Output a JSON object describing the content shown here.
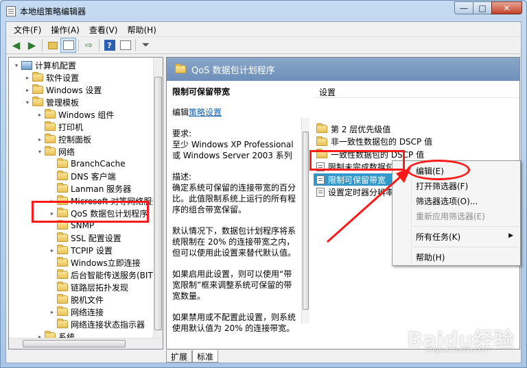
{
  "window": {
    "title": "本地组策略编辑器",
    "min": "—",
    "max": "□",
    "close": "✕"
  },
  "menu": [
    "文件(F)",
    "操作(A)",
    "查看(V)",
    "帮助(H)"
  ],
  "toolbar": {
    "icons": [
      "back-arrow-icon",
      "forward-arrow-icon",
      "up-folder-icon",
      "show-tree-icon",
      "export-icon",
      "help-icon",
      "properties-icon",
      "filter-icon"
    ]
  },
  "tree": {
    "items": [
      {
        "label": "计算机配置",
        "level": 0,
        "expander": "▾",
        "icon": "computer"
      },
      {
        "label": "软件设置",
        "level": 1,
        "expander": "▸",
        "icon": "folder"
      },
      {
        "label": "Windows 设置",
        "level": 1,
        "expander": "▸",
        "icon": "folder"
      },
      {
        "label": "管理模板",
        "level": 1,
        "expander": "▾",
        "icon": "folder"
      },
      {
        "label": "Windows 组件",
        "level": 2,
        "expander": "▸",
        "icon": "folder"
      },
      {
        "label": "打印机",
        "level": 2,
        "expander": "",
        "icon": "folder"
      },
      {
        "label": "控制面板",
        "level": 2,
        "expander": "▸",
        "icon": "folder"
      },
      {
        "label": "网络",
        "level": 2,
        "expander": "▾",
        "icon": "folder"
      },
      {
        "label": "BranchCache",
        "level": 3,
        "expander": "",
        "icon": "folder"
      },
      {
        "label": "DNS 客户端",
        "level": 3,
        "expander": "",
        "icon": "folder"
      },
      {
        "label": "Lanman 服务器",
        "level": 3,
        "expander": "",
        "icon": "folder"
      },
      {
        "label": "Microsoft 对等网络服务",
        "level": 3,
        "expander": "▸",
        "icon": "folder"
      },
      {
        "label": "QoS 数据包计划程序",
        "level": 3,
        "expander": "▸",
        "icon": "folder"
      },
      {
        "label": "SNMP",
        "level": 3,
        "expander": "",
        "icon": "folder"
      },
      {
        "label": "SSL 配置设置",
        "level": 3,
        "expander": "",
        "icon": "folder"
      },
      {
        "label": "TCPIP 设置",
        "level": 3,
        "expander": "▸",
        "icon": "folder"
      },
      {
        "label": "Windows立即连接",
        "level": 3,
        "expander": "",
        "icon": "folder"
      },
      {
        "label": "后台智能传送服务(BITS)",
        "level": 3,
        "expander": "",
        "icon": "folder"
      },
      {
        "label": "链路层拓扑发现",
        "level": 3,
        "expander": "",
        "icon": "folder"
      },
      {
        "label": "脱机文件",
        "level": 3,
        "expander": "",
        "icon": "folder"
      },
      {
        "label": "网络连接",
        "level": 3,
        "expander": "▸",
        "icon": "folder"
      },
      {
        "label": "网络连接状态指示器",
        "level": 3,
        "expander": "",
        "icon": "folder"
      },
      {
        "label": "系统",
        "level": 2,
        "expander": "▸",
        "icon": "folder"
      }
    ]
  },
  "right": {
    "header": "QoS 数据包计划程序",
    "desc": {
      "title": "限制可保留带宽",
      "edit_prefix": "编辑",
      "edit_link": "策略设置",
      "req_label": "要求:",
      "req_text": "至少 Windows XP Professional 或 Windows Server 2003 系列",
      "desc_label": "描述:",
      "desc_text": "确定系统可保留的连接带宽的百分比。此值限制系统上运行的所有程序的组合带宽保留。",
      "default_text": "默认情况下，数据包计划程序将系统限制在 20% 的连接带宽之内，但可以使用此设置来替代默认值。",
      "enable_text": "如果启用此设置，则可以使用“带宽限制”框来调整系统可保留的带宽数量。",
      "disable_text": "如果禁用或不配置此设置，则系统使用默认值为 20% 的连接带宽。"
    },
    "list_header": "设置",
    "list": [
      {
        "label": "第 2 层优先级值",
        "icon": "folder"
      },
      {
        "label": "非一致性数据包的 DSCP 值",
        "icon": "folder"
      },
      {
        "label": "一致性数据包的 DSCP 值",
        "icon": "folder"
      },
      {
        "label": "限制未完成数据包",
        "icon": "setting"
      },
      {
        "label": "限制可保留带宽",
        "icon": "setting",
        "selected": true
      },
      {
        "label": "设置定时器分辨率",
        "icon": "setting"
      }
    ]
  },
  "tabs": [
    "扩展",
    "标准"
  ],
  "context_menu": {
    "items": [
      {
        "label": "编辑(E)",
        "disabled": false
      },
      {
        "label": "打开筛选器(F)",
        "disabled": false
      },
      {
        "label": "筛选器选项(O)...",
        "disabled": false
      },
      {
        "label": "重新应用筛选器(E)",
        "disabled": true
      },
      {
        "label": "所有任务(K)",
        "disabled": false,
        "submenu": "▶"
      },
      {
        "label": "帮助(H)",
        "disabled": false
      }
    ]
  },
  "watermark": {
    "main": "Baidu经验",
    "sub": "jingyan.baidu.com"
  },
  "colors": {
    "annotation": "#ff1a1a",
    "selection": "#3399cc",
    "header": "#7496c0"
  }
}
